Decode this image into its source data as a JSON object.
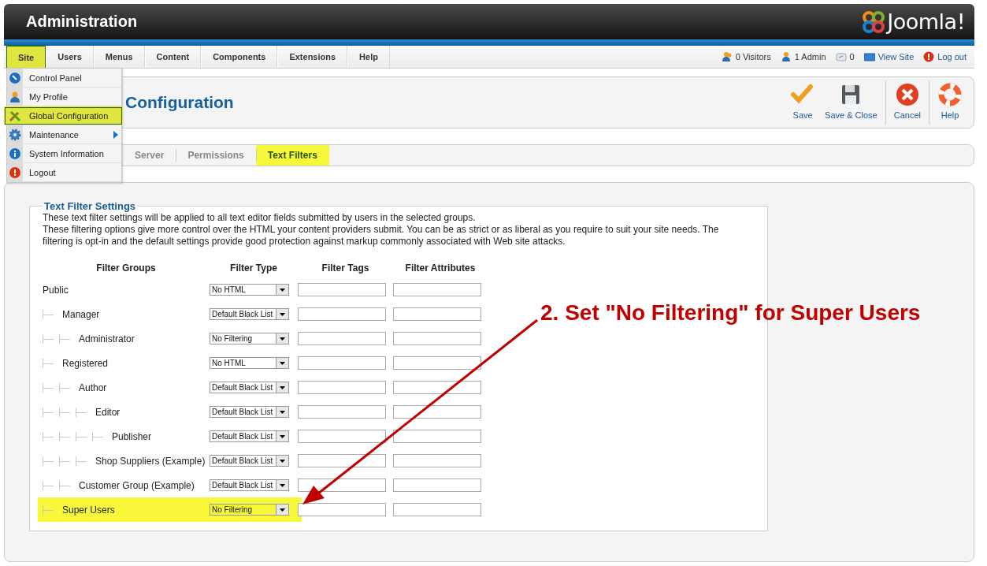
{
  "header": {
    "title": "Administration",
    "logo": "Joomla!"
  },
  "menu": [
    {
      "label": "Site",
      "selected": true
    },
    {
      "label": "Users",
      "selected": false
    },
    {
      "label": "Menus",
      "selected": false
    },
    {
      "label": "Content",
      "selected": false
    },
    {
      "label": "Components",
      "selected": false
    },
    {
      "label": "Extensions",
      "selected": false
    },
    {
      "label": "Help",
      "selected": false
    }
  ],
  "status": [
    {
      "kind": "visitors",
      "label": "0 Visitors"
    },
    {
      "kind": "admins",
      "label": "1 Admin"
    },
    {
      "kind": "messages",
      "label": "0"
    },
    {
      "kind": "view",
      "label": "View Site"
    },
    {
      "kind": "logout",
      "label": "Log out"
    }
  ],
  "dropdown": [
    {
      "kind": "panel",
      "label": "Control Panel",
      "selected": false,
      "submenu": false
    },
    {
      "kind": "profile",
      "label": "My Profile",
      "selected": false,
      "submenu": false
    },
    {
      "kind": "config",
      "label": "Global Configuration",
      "selected": true,
      "submenu": false
    },
    {
      "kind": "maintenance",
      "label": "Maintenance",
      "selected": false,
      "submenu": true
    },
    {
      "kind": "info",
      "label": "System Information",
      "selected": false,
      "submenu": false
    },
    {
      "kind": "logout",
      "label": "Logout",
      "selected": false,
      "submenu": false
    }
  ],
  "page_title": "Configuration",
  "toolbar": [
    [
      {
        "kind": "save",
        "label": "Save"
      },
      {
        "kind": "save-close",
        "label": "Save & Close"
      }
    ],
    [
      {
        "kind": "cancel",
        "label": "Cancel"
      }
    ],
    [
      {
        "kind": "help",
        "label": "Help"
      }
    ]
  ],
  "tabs": [
    {
      "label": "Server",
      "selected": false
    },
    {
      "label": "Permissions",
      "selected": false
    },
    {
      "label": "Text Filters",
      "selected": true
    }
  ],
  "fieldset": {
    "legend": "Text Filter Settings",
    "description": [
      "These text filter settings will be applied to all text editor fields submitted by users in the selected groups.",
      "These filtering options give more control over the HTML your content providers submit. You can be as strict or as liberal as you require to suit your site needs. The filtering is opt-in and the default settings provide good protection against markup commonly associated with Web site attacks."
    ]
  },
  "columns": [
    "Filter Groups",
    "Filter Type",
    "Filter Tags",
    "Filter Attributes"
  ],
  "groups": [
    {
      "name": "Public",
      "filter_type": "No HTML",
      "highlighted": false,
      "children": [
        {
          "name": "Manager",
          "filter_type": "Default Black List",
          "highlighted": false,
          "children": [
            {
              "name": "Administrator",
              "filter_type": "No Filtering",
              "highlighted": false
            }
          ]
        },
        {
          "name": "Registered",
          "filter_type": "No HTML",
          "highlighted": false,
          "children": [
            {
              "name": "Author",
              "filter_type": "Default Black List",
              "highlighted": false,
              "children": [
                {
                  "name": "Editor",
                  "filter_type": "Default Black List",
                  "highlighted": false,
                  "children": [
                    {
                      "name": "Publisher",
                      "filter_type": "Default Black List",
                      "highlighted": false
                    }
                  ]
                },
                {
                  "name": "Shop Suppliers (Example)",
                  "filter_type": "Default Black List",
                  "highlighted": false
                }
              ]
            },
            {
              "name": "Customer Group (Example)",
              "filter_type": "Default Black List",
              "highlighted": false
            }
          ]
        },
        {
          "name": "Super Users",
          "filter_type": "No Filtering",
          "highlighted": true
        }
      ]
    }
  ],
  "annotation": {
    "text": "2. Set \"No Filtering\" for Super Users"
  }
}
